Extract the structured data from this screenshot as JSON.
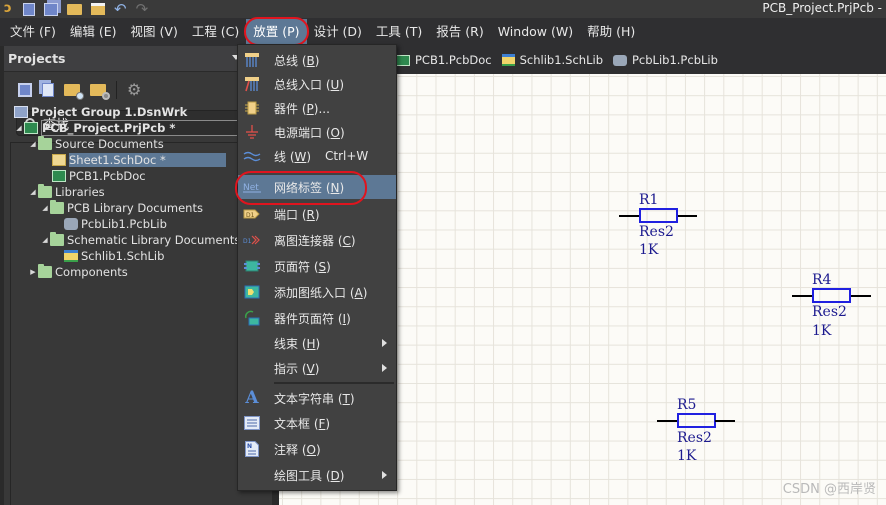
{
  "titlebar": {
    "title": "PCB_Project.PrjPcb -",
    "quick_access": [
      "app-logo-icon",
      "save-icon",
      "save-all-icon",
      "open-icon",
      "open-project-icon",
      "undo-icon",
      "redo-icon"
    ]
  },
  "menubar": {
    "items": [
      {
        "label": "文件 (F)"
      },
      {
        "label": "编辑 (E)"
      },
      {
        "label": "视图 (V)"
      },
      {
        "label": "工程 (C)"
      },
      {
        "label": "放置 (P)",
        "active": true
      },
      {
        "label": "设计 (D)"
      },
      {
        "label": "工具 (T)"
      },
      {
        "label": "报告 (R)"
      },
      {
        "label": "Window (W)"
      },
      {
        "label": "帮助 (H)"
      }
    ]
  },
  "projects_panel": {
    "title": "Projects",
    "toolbar": [
      "save-icon",
      "copy-icon",
      "open-folder-icon",
      "folder-settings-icon",
      "gear-icon"
    ],
    "search": {
      "placeholder": "查找",
      "value": ""
    },
    "tree": [
      {
        "label": "Project Group 1.DsnWrk",
        "level": 0,
        "icon": "project-group-icon",
        "expander": ""
      },
      {
        "label": "PCB_Project.PrjPcb *",
        "level": 0,
        "icon": "pcb-project-icon",
        "expander": "expanded",
        "bold": true
      },
      {
        "label": "Source Documents",
        "level": 1,
        "icon": "folder-icon",
        "expander": "expanded"
      },
      {
        "label": "Sheet1.SchDoc *",
        "level": 2,
        "icon": "schdoc-icon",
        "expander": "",
        "selected": true
      },
      {
        "label": "PCB1.PcbDoc",
        "level": 2,
        "icon": "pcbdoc-icon",
        "expander": ""
      },
      {
        "label": "Libraries",
        "level": 1,
        "icon": "folder-icon",
        "expander": "expanded"
      },
      {
        "label": "PCB Library Documents",
        "level": 2,
        "icon": "folder-icon",
        "expander": "expanded"
      },
      {
        "label": "PcbLib1.PcbLib",
        "level": 3,
        "icon": "pcblib-icon",
        "expander": ""
      },
      {
        "label": "Schematic Library Documents",
        "level": 2,
        "icon": "folder-icon",
        "expander": "expanded"
      },
      {
        "label": "Schlib1.SchLib",
        "level": 3,
        "icon": "schlib-icon",
        "expander": ""
      },
      {
        "label": "Components",
        "level": 1,
        "icon": "folder-icon",
        "expander": "collapsed"
      }
    ]
  },
  "document_tabs": [
    {
      "label": "PCB1.PcbDoc",
      "icon": "pcbdoc-icon"
    },
    {
      "label": "Schlib1.SchLib",
      "icon": "schlib-icon"
    },
    {
      "label": "PcbLib1.PcbLib",
      "icon": "pcblib-icon"
    }
  ],
  "place_menu": {
    "items": [
      {
        "label": "总线",
        "key": "B",
        "icon": "bus-icon"
      },
      {
        "label": "总线入口",
        "key": "U",
        "icon": "bus-entry-icon"
      },
      {
        "label": "器件",
        "key": "P",
        "suffix": "...",
        "icon": "part-icon"
      },
      {
        "label": "电源端口",
        "key": "O",
        "icon": "power-port-icon"
      },
      {
        "label": "线",
        "key": "W",
        "shortcut": "Ctrl+W",
        "icon": "wire-icon"
      },
      {
        "label": "网络标签",
        "key": "N",
        "icon": "net-label-icon",
        "highlighted": true
      },
      {
        "label": "端口",
        "key": "R",
        "icon": "port-icon"
      },
      {
        "label": "离图连接器",
        "key": "C",
        "icon": "off-sheet-connector-icon"
      },
      {
        "label": "页面符",
        "key": "S",
        "icon": "sheet-symbol-icon"
      },
      {
        "label": "添加图纸入口",
        "key": "A",
        "icon": "sheet-entry-icon"
      },
      {
        "label": "器件页面符",
        "key": "I",
        "icon": "device-sheet-symbol-icon"
      },
      {
        "label": "线束",
        "key": "H",
        "icon": "",
        "submenu": true
      },
      {
        "label": "指示",
        "key": "V",
        "icon": "",
        "submenu": true
      },
      {
        "label": "文本字符串",
        "key": "T",
        "icon": "text-string-icon"
      },
      {
        "label": "文本框",
        "key": "F",
        "icon": "text-frame-icon"
      },
      {
        "label": "注释",
        "key": "O",
        "icon": "note-icon"
      },
      {
        "label": "绘图工具",
        "key": "D",
        "icon": "",
        "submenu": true
      }
    ]
  },
  "schematic": {
    "components": [
      {
        "designator": "R1",
        "comment": "Res2",
        "value": "1K"
      },
      {
        "designator": "R4",
        "comment": "Res2",
        "value": "1K"
      },
      {
        "designator": "R5",
        "comment": "Res2",
        "value": "1K"
      }
    ]
  },
  "watermark": "CSDN @西岸贤",
  "colors": {
    "accent": "#5d7895",
    "annotation_circle": "#e0141e",
    "component_body": "#2020e0",
    "component_text": "#1d1b8f",
    "canvas": "#fcfbf7"
  }
}
